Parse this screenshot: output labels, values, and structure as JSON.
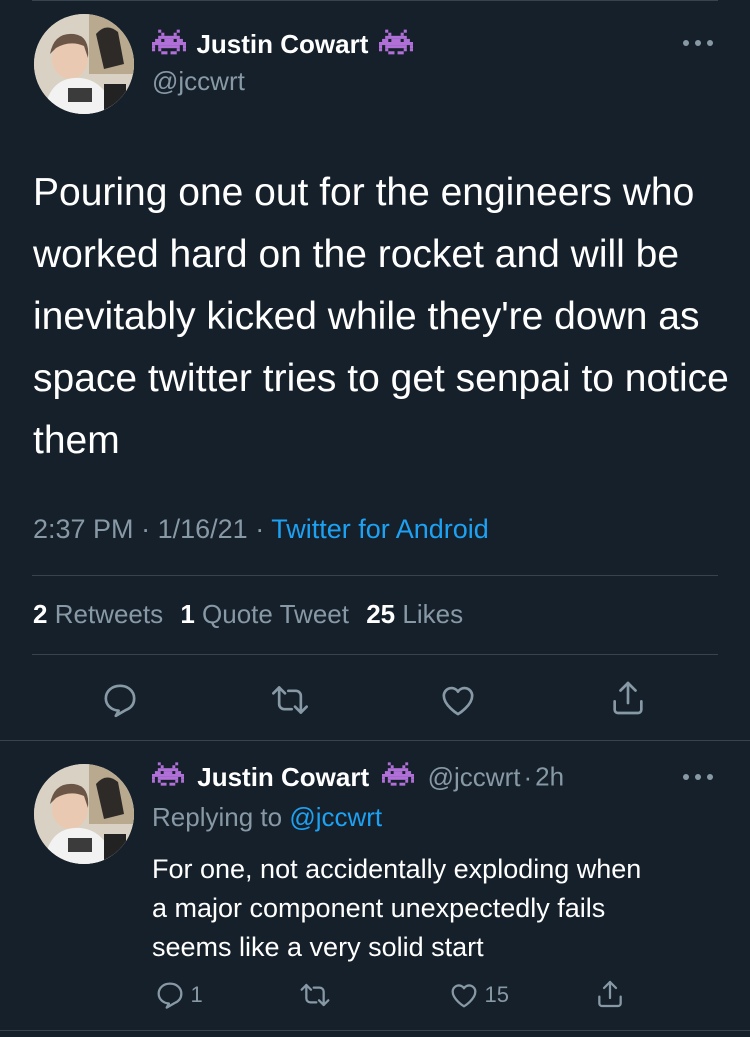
{
  "tweet": {
    "author_name": "Justin Cowart",
    "author_handle": "@jccwrt",
    "text": "Pouring one out for the engineers who worked hard on the rocket and will be inevitably kicked while they're down as space twitter tries to get senpai to notice them",
    "time": "2:37 PM",
    "date": "1/16/21",
    "source": "Twitter for Android",
    "separator": "·",
    "stats": {
      "retweets_count": "2",
      "retweets_label": "Retweets",
      "quotes_count": "1",
      "quotes_label": "Quote Tweet",
      "likes_count": "25",
      "likes_label": "Likes"
    },
    "more_icon": "more-horizontal-icon"
  },
  "reply": {
    "author_name": "Justin Cowart",
    "author_handle": "@jccwrt",
    "age": "2h",
    "replying_prefix": "Replying to",
    "replying_handle": "@jccwrt",
    "text_lines": [
      "For one, not accidentally exploding when",
      "a major component unexpectedly fails",
      "seems like a very solid start"
    ],
    "reply_count": "1",
    "like_count": "15"
  },
  "icons": {
    "name_emoji": "alien-monster-icon",
    "reply": "reply-icon",
    "retweet": "retweet-icon",
    "like": "heart-icon",
    "share": "share-icon"
  },
  "colors": {
    "background": "#15202b",
    "text": "#ffffff",
    "muted": "#8899a6",
    "accent": "#1da1f2",
    "divider": "#38444d"
  }
}
